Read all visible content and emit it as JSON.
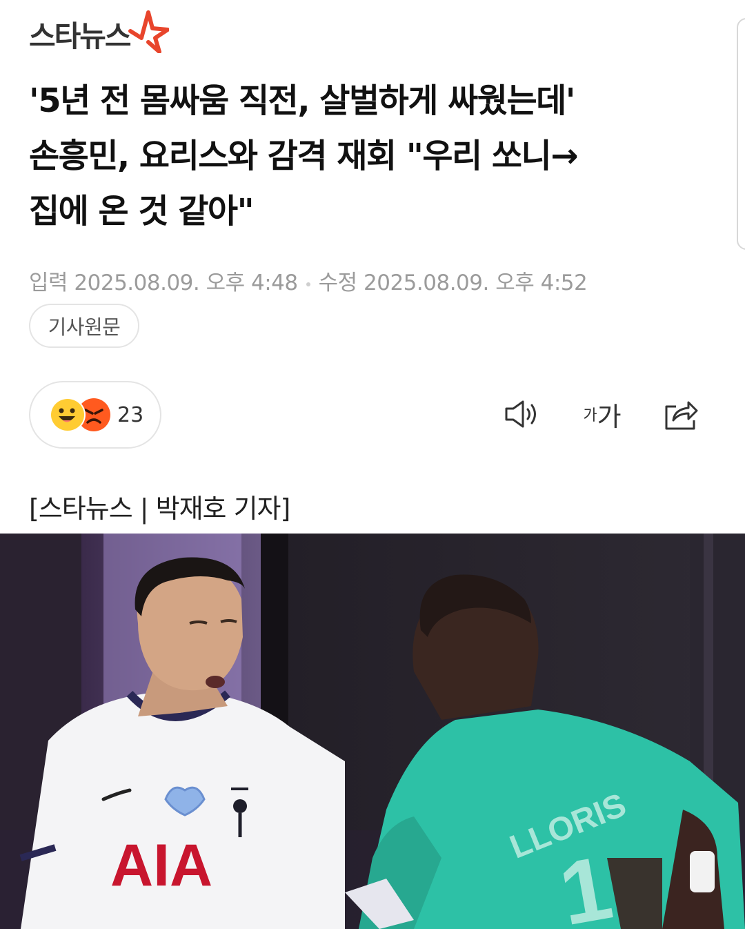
{
  "header": {
    "logo_text": "스타뉴스",
    "logo_icon": "star-logo-icon",
    "accent_color": "#e8452c"
  },
  "article": {
    "headline": "'5년 전 몸싸움 직전, 살벌하게 싸웠는데'\n손흥민, 요리스와 감격 재회 \"우리 쏘니→\n집에 온 것 같아\"",
    "published_label": "입력 2025.08.09. 오후 4:48",
    "modified_label": "수정 2025.08.09. 오후 4:52",
    "source_button": "기사원문",
    "byline": "[스타뉴스 | 박재호 기자]"
  },
  "reactions": {
    "count": "23",
    "icons": [
      "smile-emoji-icon",
      "angry-emoji-icon"
    ]
  },
  "toolbar": {
    "speaker_icon": "speaker-icon",
    "font_small": "가",
    "font_large": "가",
    "share_icon": "share-icon"
  },
  "photo": {
    "jersey_sponsor": "AIA",
    "jersey_name": "LLORIS",
    "jersey_number": "1"
  }
}
